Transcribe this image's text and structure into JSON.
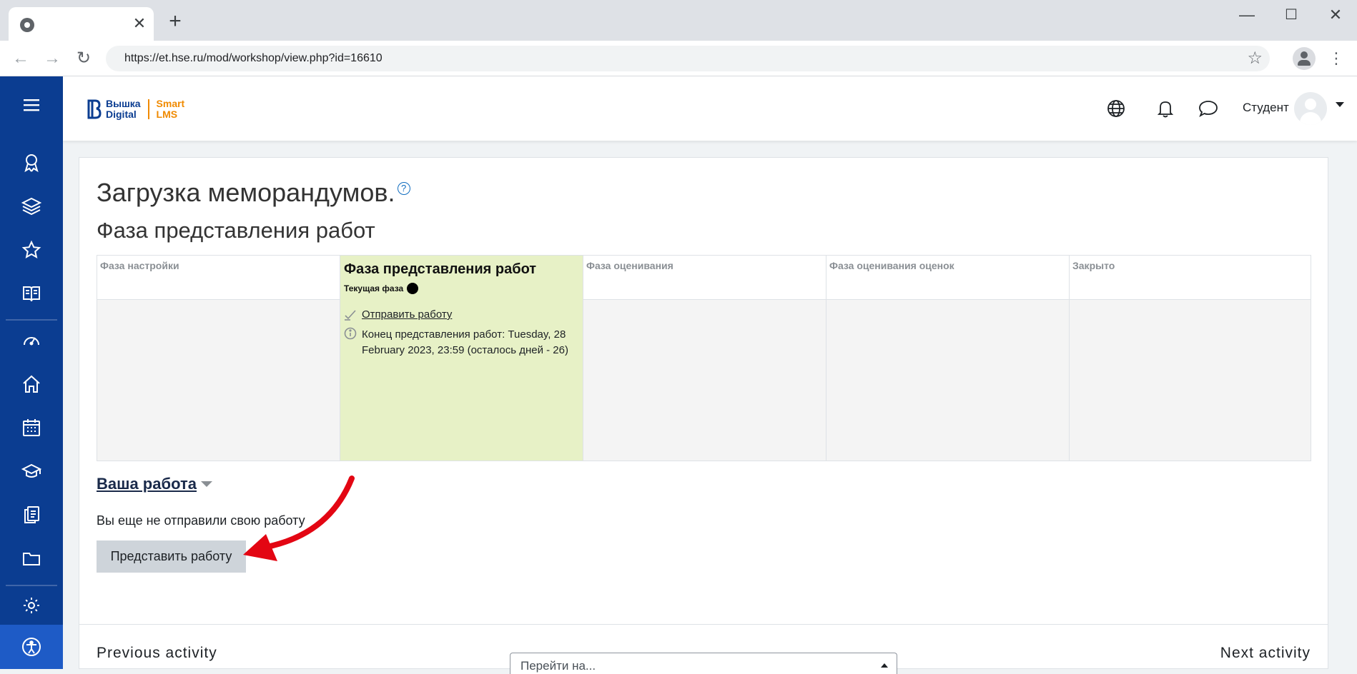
{
  "browser": {
    "tab_close": "✕",
    "new_tab": "+",
    "url": "https://et.hse.ru/mod/workshop/view.php?id=16610",
    "window_minimize": "—",
    "window_maximize": "☐",
    "window_close": "✕"
  },
  "header": {
    "logo_line1": "Вышка",
    "logo_line2": "Digital",
    "logo_smart": "Smart",
    "logo_lms": "LMS",
    "user_name": "Студент"
  },
  "page": {
    "title": "Загрузка меморандумов.",
    "help_glyph": "?",
    "current_phase_heading": "Фаза представления работ"
  },
  "phases": [
    {
      "label": "Фаза настройки"
    },
    {
      "label": "Фаза представления работ",
      "current_label": "Текущая фаза",
      "tasks": [
        {
          "text": "Отправить работу",
          "link": true
        },
        {
          "text": "Конец представления работ: Tuesday, 28 February 2023, 23:59 (осталось дней - 26)",
          "link": false
        }
      ]
    },
    {
      "label": "Фаза оценивания"
    },
    {
      "label": "Фаза оценивания оценок"
    },
    {
      "label": "Закрыто"
    }
  ],
  "your_work": {
    "heading": "Ваша работа",
    "status": "Вы еще не отправили свою работу",
    "submit_label": "Представить работу"
  },
  "footer_nav": {
    "previous": "Previous activity",
    "next": "Next activity",
    "jump_placeholder": "Перейти на..."
  },
  "colors": {
    "rail": "#0b3d91",
    "brand_orange": "#f08a00",
    "active_phase": "#e7f1c6",
    "annotation_arrow": "#e30613"
  }
}
